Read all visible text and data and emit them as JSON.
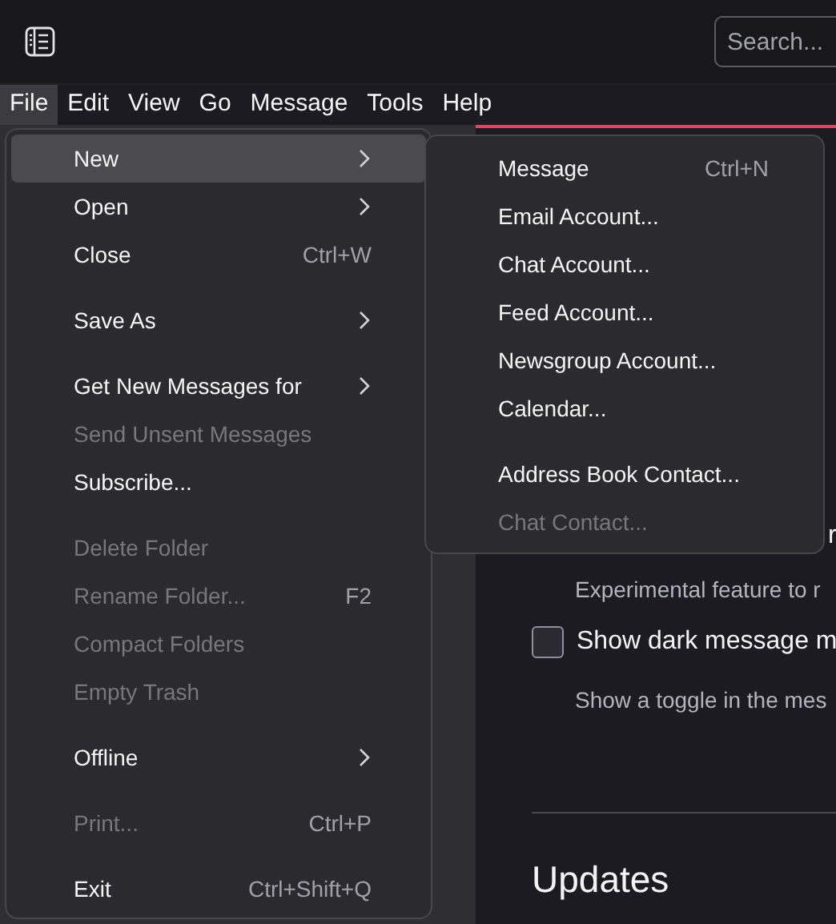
{
  "toolbar": {
    "search": {
      "placeholder": "Search..."
    }
  },
  "menubar": [
    {
      "label": "File",
      "selected": true
    },
    {
      "label": "Edit",
      "selected": false
    },
    {
      "label": "View",
      "selected": false
    },
    {
      "label": "Go",
      "selected": false
    },
    {
      "label": "Message",
      "selected": false
    },
    {
      "label": "Tools",
      "selected": false
    },
    {
      "label": "Help",
      "selected": false
    }
  ],
  "file_menu": [
    {
      "kind": "item",
      "label": "New",
      "submenu": true,
      "selected": true,
      "disabled": false
    },
    {
      "kind": "item",
      "label": "Open",
      "submenu": true,
      "selected": false,
      "disabled": false
    },
    {
      "kind": "item",
      "label": "Close",
      "shortcut": "Ctrl+W",
      "selected": false,
      "disabled": false
    },
    {
      "kind": "separator"
    },
    {
      "kind": "item",
      "label": "Save As",
      "submenu": true,
      "selected": false,
      "disabled": false
    },
    {
      "kind": "separator"
    },
    {
      "kind": "item",
      "label": "Get New Messages for",
      "submenu": true,
      "selected": false,
      "disabled": false
    },
    {
      "kind": "item",
      "label": "Send Unsent Messages",
      "selected": false,
      "disabled": true
    },
    {
      "kind": "item",
      "label": "Subscribe...",
      "selected": false,
      "disabled": false
    },
    {
      "kind": "separator"
    },
    {
      "kind": "item",
      "label": "Delete Folder",
      "selected": false,
      "disabled": true
    },
    {
      "kind": "item",
      "label": "Rename Folder...",
      "shortcut": "F2",
      "selected": false,
      "disabled": true
    },
    {
      "kind": "item",
      "label": "Compact Folders",
      "selected": false,
      "disabled": true
    },
    {
      "kind": "item",
      "label": "Empty Trash",
      "selected": false,
      "disabled": true
    },
    {
      "kind": "separator"
    },
    {
      "kind": "item",
      "label": "Offline",
      "submenu": true,
      "selected": false,
      "disabled": false
    },
    {
      "kind": "separator"
    },
    {
      "kind": "item",
      "label": "Print...",
      "shortcut": "Ctrl+P",
      "selected": false,
      "disabled": true
    },
    {
      "kind": "separator"
    },
    {
      "kind": "item",
      "label": "Exit",
      "shortcut": "Ctrl+Shift+Q",
      "selected": false,
      "disabled": false
    }
  ],
  "new_submenu": [
    {
      "kind": "item",
      "label": "Message",
      "shortcut": "Ctrl+N",
      "disabled": false
    },
    {
      "kind": "item",
      "label": "Email Account...",
      "disabled": false
    },
    {
      "kind": "item",
      "label": "Chat Account...",
      "disabled": false
    },
    {
      "kind": "item",
      "label": "Feed Account...",
      "disabled": false
    },
    {
      "kind": "item",
      "label": "Newsgroup Account...",
      "disabled": false
    },
    {
      "kind": "item",
      "label": "Calendar...",
      "disabled": false
    },
    {
      "kind": "separator"
    },
    {
      "kind": "item",
      "label": "Address Book Contact...",
      "disabled": false
    },
    {
      "kind": "item",
      "label": "Chat Contact...",
      "disabled": true
    }
  ],
  "settings": {
    "cut_label": "r",
    "description_1": "Experimental feature to r",
    "option": {
      "label": "Show dark message m",
      "checked": false
    },
    "description_2": "Show a toggle in the mes",
    "section_title": "Updates"
  }
}
